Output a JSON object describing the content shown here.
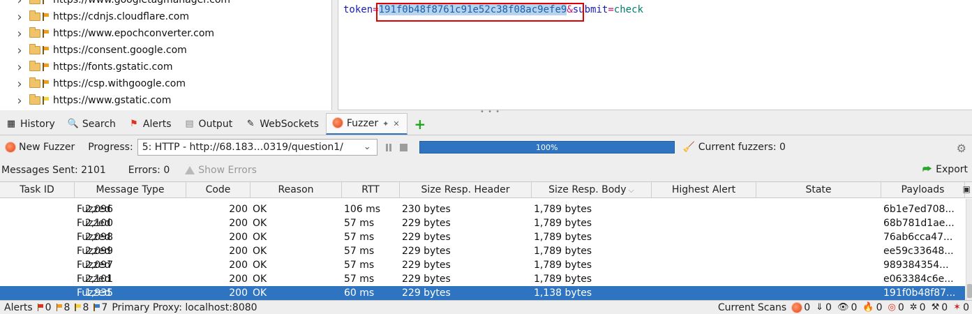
{
  "sites_tree": [
    {
      "label": "https://www.googletagmanager.com",
      "flag": "orange"
    },
    {
      "label": "https://cdnjs.cloudflare.com",
      "flag": "orange"
    },
    {
      "label": "https://www.epochconverter.com",
      "flag": "orange"
    },
    {
      "label": "https://consent.google.com",
      "flag": "orange"
    },
    {
      "label": "https://fonts.gstatic.com",
      "flag": "orange"
    },
    {
      "label": "https://csp.withgoogle.com",
      "flag": "orange"
    },
    {
      "label": "https://www.gstatic.com",
      "flag": "yellow"
    }
  ],
  "request_body": {
    "key1": "token",
    "eq": "=",
    "value1": "191f0b48f8761c91e52c38f08ac9efe9",
    "amp": "&",
    "key2": "submit",
    "value2": "check"
  },
  "tabs": [
    {
      "label": "History",
      "icon": "history-icon"
    },
    {
      "label": "Search",
      "icon": "search-icon"
    },
    {
      "label": "Alerts",
      "icon": "alerts-flag-icon"
    },
    {
      "label": "Output",
      "icon": "output-icon"
    },
    {
      "label": "WebSockets",
      "icon": "websockets-icon"
    },
    {
      "label": "Fuzzer",
      "icon": "fuzzer-icon",
      "active": true
    }
  ],
  "toolbar": {
    "new_fuzzer": "New Fuzzer",
    "progress_label": "Progress:",
    "progress_selected": "5: HTTP - http://68.183…0319/question1/",
    "progress_percent_text": "100%",
    "progress_value": 1.0,
    "current_fuzzers": "Current fuzzers: 0"
  },
  "stats": {
    "messages_sent": "Messages Sent: 2101",
    "errors": "Errors: 0",
    "show_errors": "Show Errors",
    "export": "Export"
  },
  "table": {
    "columns": [
      "Task ID",
      "Message Type",
      "Code",
      "Reason",
      "RTT",
      "Size Resp. Header",
      "Size Resp. Body",
      "Highest Alert",
      "State",
      "Payloads"
    ],
    "rows": [
      {
        "task_id": "2,096",
        "type": "Fuzzed",
        "code": "200",
        "reason": "OK",
        "rtt": "106 ms",
        "hdr": "230 bytes",
        "body": "1,789 bytes",
        "alert": "",
        "state": "",
        "payload": "6b1e7ed708..."
      },
      {
        "task_id": "2,100",
        "type": "Fuzzed",
        "code": "200",
        "reason": "OK",
        "rtt": "57 ms",
        "hdr": "229 bytes",
        "body": "1,789 bytes",
        "alert": "",
        "state": "",
        "payload": "68b781d1ae..."
      },
      {
        "task_id": "2,098",
        "type": "Fuzzed",
        "code": "200",
        "reason": "OK",
        "rtt": "57 ms",
        "hdr": "229 bytes",
        "body": "1,789 bytes",
        "alert": "",
        "state": "",
        "payload": "76ab6cca47..."
      },
      {
        "task_id": "2,099",
        "type": "Fuzzed",
        "code": "200",
        "reason": "OK",
        "rtt": "57 ms",
        "hdr": "229 bytes",
        "body": "1,789 bytes",
        "alert": "",
        "state": "",
        "payload": "ee59c33648..."
      },
      {
        "task_id": "2,097",
        "type": "Fuzzed",
        "code": "200",
        "reason": "OK",
        "rtt": "57 ms",
        "hdr": "229 bytes",
        "body": "1,789 bytes",
        "alert": "",
        "state": "",
        "payload": "989384354..."
      },
      {
        "task_id": "2,101",
        "type": "Fuzzed",
        "code": "200",
        "reason": "OK",
        "rtt": "57 ms",
        "hdr": "229 bytes",
        "body": "1,789 bytes",
        "alert": "",
        "state": "",
        "payload": "e063384c6e..."
      },
      {
        "task_id": "1,935",
        "type": "Fuzzed",
        "code": "200",
        "reason": "OK",
        "rtt": "60 ms",
        "hdr": "229 bytes",
        "body": "1,138 bytes",
        "alert": "",
        "state": "",
        "payload": "191f0b48f87...",
        "selected": true
      }
    ]
  },
  "status_bar": {
    "alerts_label": "Alerts",
    "alert_counts": [
      {
        "color": "red",
        "count": "0"
      },
      {
        "color": "orange",
        "count": "8"
      },
      {
        "color": "yellow",
        "count": "8"
      },
      {
        "color": "blue",
        "count": "7"
      }
    ],
    "proxy": "Primary Proxy: localhost:8080",
    "current_scans_label": "Current Scans",
    "scans": [
      {
        "icon": "fuzzer-icon",
        "glyph": "✹",
        "count": "0"
      },
      {
        "icon": "spider-download-icon",
        "glyph": "⇓",
        "count": "0"
      },
      {
        "icon": "passive-scan-eye-icon",
        "glyph": "👁",
        "count": "0"
      },
      {
        "icon": "active-scan-flame-icon",
        "glyph": "🔥",
        "count": "0"
      },
      {
        "icon": "target-icon",
        "glyph": "◎",
        "count": "0"
      },
      {
        "icon": "spider-icon",
        "glyph": "✲",
        "count": "0"
      },
      {
        "icon": "tools-icon",
        "glyph": "⚒",
        "count": "0"
      },
      {
        "icon": "bug-icon",
        "glyph": "✶",
        "count": "0"
      }
    ]
  },
  "colors": {
    "accent": "#2f74c0",
    "highlight_box": "#e00000"
  }
}
